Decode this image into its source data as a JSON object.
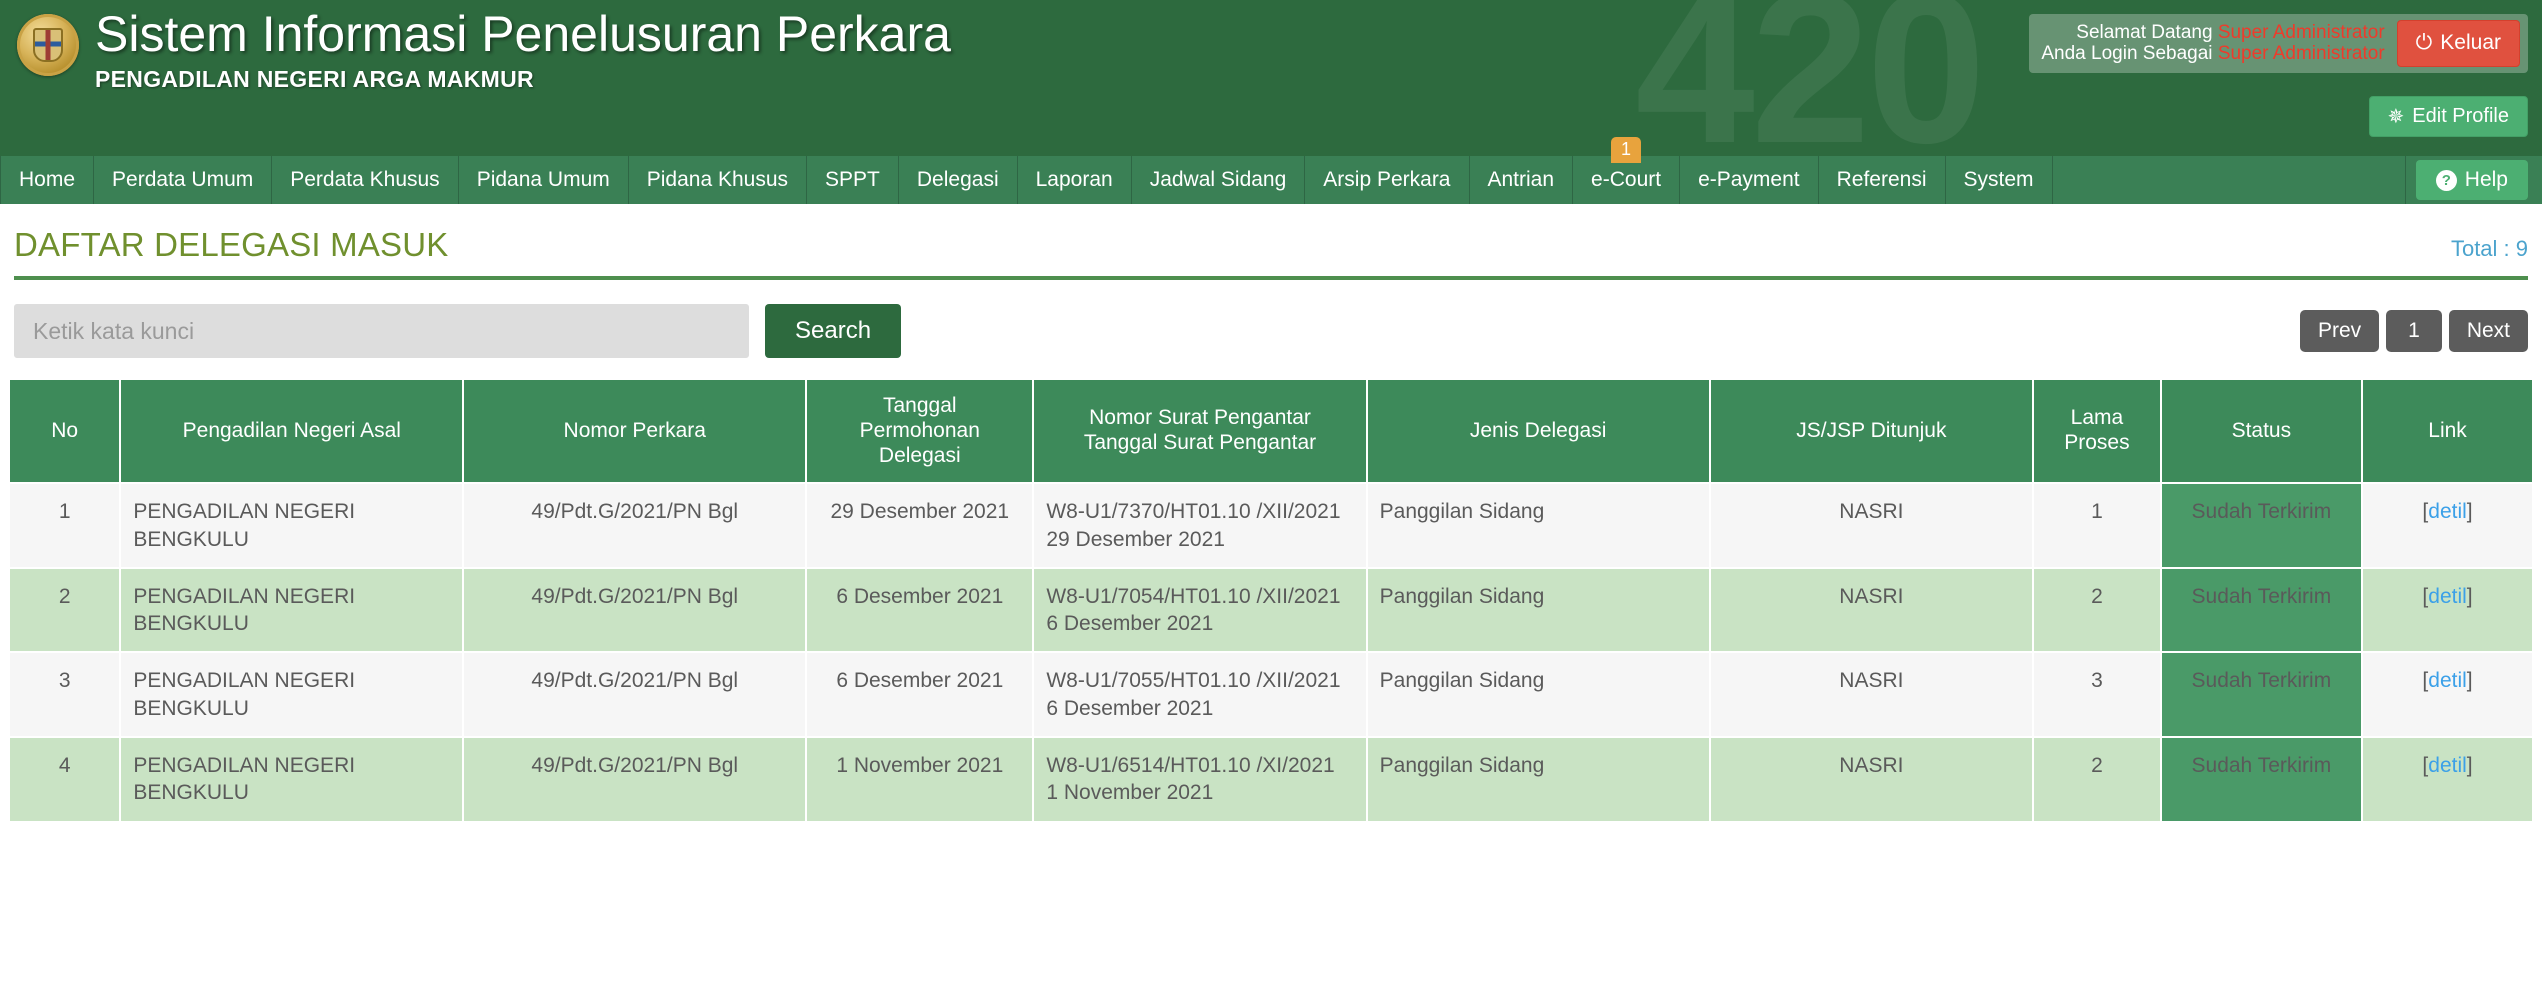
{
  "header": {
    "watermark": "420",
    "app_title": "Sistem Informasi Penelusuran Perkara",
    "app_subtitle": "PENGADILAN NEGERI ARGA MAKMUR",
    "welcome_label": "Selamat Datang",
    "welcome_name": "Super Administrator",
    "role_label": "Anda Login Sebagai",
    "role_name": "Super Administrator",
    "logout_label": "Keluar",
    "edit_profile_label": "Edit Profile"
  },
  "nav": {
    "items": [
      {
        "label": "Home"
      },
      {
        "label": "Perdata Umum"
      },
      {
        "label": "Perdata Khusus"
      },
      {
        "label": "Pidana Umum"
      },
      {
        "label": "Pidana Khusus"
      },
      {
        "label": "SPPT"
      },
      {
        "label": "Delegasi"
      },
      {
        "label": "Laporan"
      },
      {
        "label": "Jadwal Sidang"
      },
      {
        "label": "Arsip Perkara"
      },
      {
        "label": "Antrian"
      },
      {
        "label": "e-Court",
        "badge": "1"
      },
      {
        "label": "e-Payment"
      },
      {
        "label": "Referensi"
      },
      {
        "label": "System"
      }
    ],
    "help_label": "Help"
  },
  "page": {
    "title": "DAFTAR DELEGASI MASUK",
    "total": "Total : 9"
  },
  "search": {
    "placeholder": "Ketik kata kunci",
    "value": "",
    "button_label": "Search"
  },
  "pagination": {
    "prev_label": "Prev",
    "current_page": "1",
    "next_label": "Next"
  },
  "table": {
    "columns": [
      "No",
      "Pengadilan Negeri Asal",
      "Nomor Perkara",
      "Tanggal Permohonan Delegasi",
      "Nomor Surat Pengantar Tanggal Surat Pengantar",
      "Jenis Delegasi",
      "JS/JSP Ditunjuk",
      "Lama Proses",
      "Status",
      "Link"
    ],
    "columns_multiline": {
      "tanggal": [
        "Tanggal",
        "Permohonan",
        "Delegasi"
      ],
      "surat": [
        "Nomor Surat Pengantar",
        "Tanggal Surat Pengantar"
      ],
      "lama": [
        "Lama",
        "Proses"
      ]
    },
    "rows": [
      {
        "no": "1",
        "asal": "PENGADILAN NEGERI BENGKULU",
        "perkara": "49/Pdt.G/2021/PN Bgl",
        "tanggal": "29 Desember 2021",
        "surat_nomor": "W8-U1/7370/HT01.10 /XII/2021",
        "surat_tanggal": "29 Desember 2021",
        "jenis": "Panggilan Sidang",
        "js": "NASRI",
        "lama": "1",
        "status": "Sudah Terkirim",
        "link": "detil"
      },
      {
        "no": "2",
        "asal": "PENGADILAN NEGERI BENGKULU",
        "perkara": "49/Pdt.G/2021/PN Bgl",
        "tanggal": "6 Desember 2021",
        "surat_nomor": "W8-U1/7054/HT01.10 /XII/2021",
        "surat_tanggal": "6 Desember 2021",
        "jenis": "Panggilan Sidang",
        "js": "NASRI",
        "lama": "2",
        "status": "Sudah Terkirim",
        "link": "detil"
      },
      {
        "no": "3",
        "asal": "PENGADILAN NEGERI BENGKULU",
        "perkara": "49/Pdt.G/2021/PN Bgl",
        "tanggal": "6 Desember 2021",
        "surat_nomor": "W8-U1/7055/HT01.10 /XII/2021",
        "surat_tanggal": "6 Desember 2021",
        "jenis": "Panggilan Sidang",
        "js": "NASRI",
        "lama": "3",
        "status": "Sudah Terkirim",
        "link": "detil"
      },
      {
        "no": "4",
        "asal": "PENGADILAN NEGERI BENGKULU",
        "perkara": "49/Pdt.G/2021/PN Bgl",
        "tanggal": "1 November 2021",
        "surat_nomor": "W8-U1/6514/HT01.10 /XI/2021",
        "surat_tanggal": "1 November 2021",
        "jenis": "Panggilan Sidang",
        "js": "NASRI",
        "lama": "2",
        "status": "Sudah Terkirim",
        "link": "detil"
      }
    ]
  },
  "colors": {
    "brand_green": "#2d6a3e",
    "nav_green": "#3a8055",
    "title_olive": "#70902e",
    "total_blue": "#4ba3cd",
    "logout_red": "#e0513f",
    "badge_orange": "#e8a33d",
    "status_green": "#4a9a68",
    "row_even_green": "#c9e3c4",
    "link_blue": "#3ba0e8"
  }
}
